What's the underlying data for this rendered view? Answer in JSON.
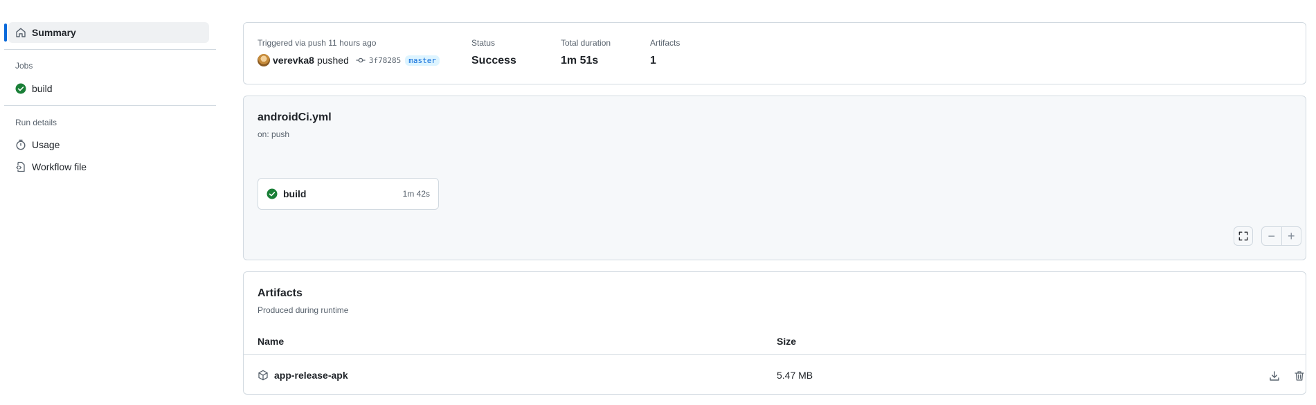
{
  "sidebar": {
    "summary_label": "Summary",
    "jobs_heading": "Jobs",
    "jobs": [
      {
        "label": "build",
        "status": "success"
      }
    ],
    "run_details_heading": "Run details",
    "run_details": [
      {
        "label": "Usage",
        "icon": "stopwatch-icon"
      },
      {
        "label": "Workflow file",
        "icon": "file-code-icon"
      }
    ]
  },
  "summary": {
    "trigger_text": "Triggered via push 11 hours ago",
    "user": "verevka8",
    "action": "pushed",
    "commit_sha": "3f78285",
    "branch": "master",
    "status_label": "Status",
    "status_value": "Success",
    "duration_label": "Total duration",
    "duration_value": "1m 51s",
    "artifacts_label": "Artifacts",
    "artifacts_value": "1"
  },
  "workflow": {
    "file_name": "androidCi.yml",
    "trigger": "on: push",
    "job": {
      "name": "build",
      "duration": "1m 42s"
    },
    "controls": {
      "zoom_out": "−",
      "zoom_in": "+"
    }
  },
  "artifacts": {
    "title": "Artifacts",
    "subtitle": "Produced during runtime",
    "columns": {
      "name": "Name",
      "size": "Size"
    },
    "rows": [
      {
        "name": "app-release-apk",
        "size": "5.47 MB"
      }
    ]
  },
  "colors": {
    "accent": "#0969da",
    "success": "#1a7f37",
    "border": "#d1d9e0",
    "muted": "#59636e"
  }
}
